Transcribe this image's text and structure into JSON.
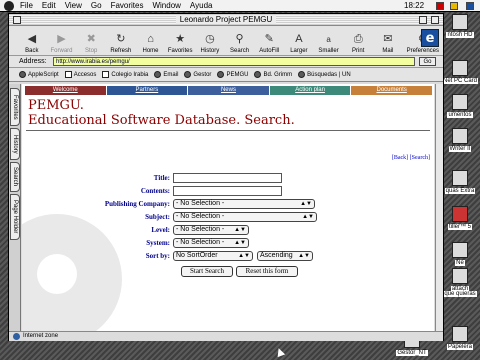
{
  "menubar": {
    "items": [
      "File",
      "Edit",
      "View",
      "Go",
      "Favorites",
      "Window",
      "Ayuda"
    ],
    "clock": "18:22"
  },
  "window": {
    "title": "Leonardo Project PEMGU"
  },
  "toolbar": {
    "buttons": [
      {
        "label": "Back",
        "icon": "back-arrow-icon"
      },
      {
        "label": "Forward",
        "icon": "forward-arrow-icon"
      },
      {
        "label": "Stop",
        "icon": "stop-icon"
      },
      {
        "label": "Refresh",
        "icon": "refresh-icon"
      },
      {
        "label": "Home",
        "icon": "home-icon"
      },
      {
        "label": "Favorites",
        "icon": "favorites-icon"
      },
      {
        "label": "History",
        "icon": "history-icon"
      },
      {
        "label": "Search",
        "icon": "search-icon"
      },
      {
        "label": "AutoFill",
        "icon": "autofill-icon"
      },
      {
        "label": "Larger",
        "icon": "larger-text-icon"
      },
      {
        "label": "Smaller",
        "icon": "smaller-text-icon"
      },
      {
        "label": "Print",
        "icon": "print-icon"
      },
      {
        "label": "Mail",
        "icon": "mail-icon"
      },
      {
        "label": "Preferences",
        "icon": "preferences-icon"
      }
    ]
  },
  "address": {
    "label": "Address:",
    "value": "http://www.irabia.es/pemgu/",
    "go": "Go"
  },
  "favorites_bar": {
    "items": [
      "AppleScript",
      "Accesos",
      "Colegio Irabia",
      "Email",
      "Gestor",
      "PEMGU",
      "Bd. Grimm",
      "Búsquedas | UN"
    ]
  },
  "side_tabs": [
    "Favorites",
    "History",
    "Search",
    "Page Holder"
  ],
  "page": {
    "nav": [
      {
        "label": "Welcome",
        "color": "#8b2d2d"
      },
      {
        "label": "Partners",
        "color": "#2e5594"
      },
      {
        "label": "News",
        "color": "#3d5f9b"
      },
      {
        "label": "Action plan",
        "color": "#3e8a7a"
      },
      {
        "label": "Documents",
        "color": "#c6803a"
      }
    ],
    "title_line1": "PEMGU.",
    "title_line2": "Educational Software Database. Search.",
    "links": "[Back] [Search]",
    "form": {
      "title_label": "Title:",
      "contents_label": "Contents:",
      "publishing_label": "Publishing Company:",
      "publishing_value": "- No Selection -",
      "subject_label": "Subject:",
      "subject_value": "- No Selection -",
      "level_label": "Level:",
      "level_value": "- No Selection -",
      "system_label": "System:",
      "system_value": "- No Selection -",
      "sort_label": "Sort by:",
      "sort_value": "No SortOrder",
      "order_value": "Ascending",
      "start_button": "Start Search",
      "reset_button": "Reset this form"
    }
  },
  "status": {
    "text": "Internet zone"
  },
  "desktop_icons": [
    "ntosh HD",
    "Net PC Card",
    "umentos",
    "Writer II",
    "quas Extra",
    "tiller™ 5",
    "Ne",
    "attach",
    "que quieras",
    "Gestor_NT",
    "Papelera"
  ],
  "colors": {
    "title_red": "#8a0000",
    "label_blue": "#00008b",
    "address_bg": "#f3ff9e"
  }
}
